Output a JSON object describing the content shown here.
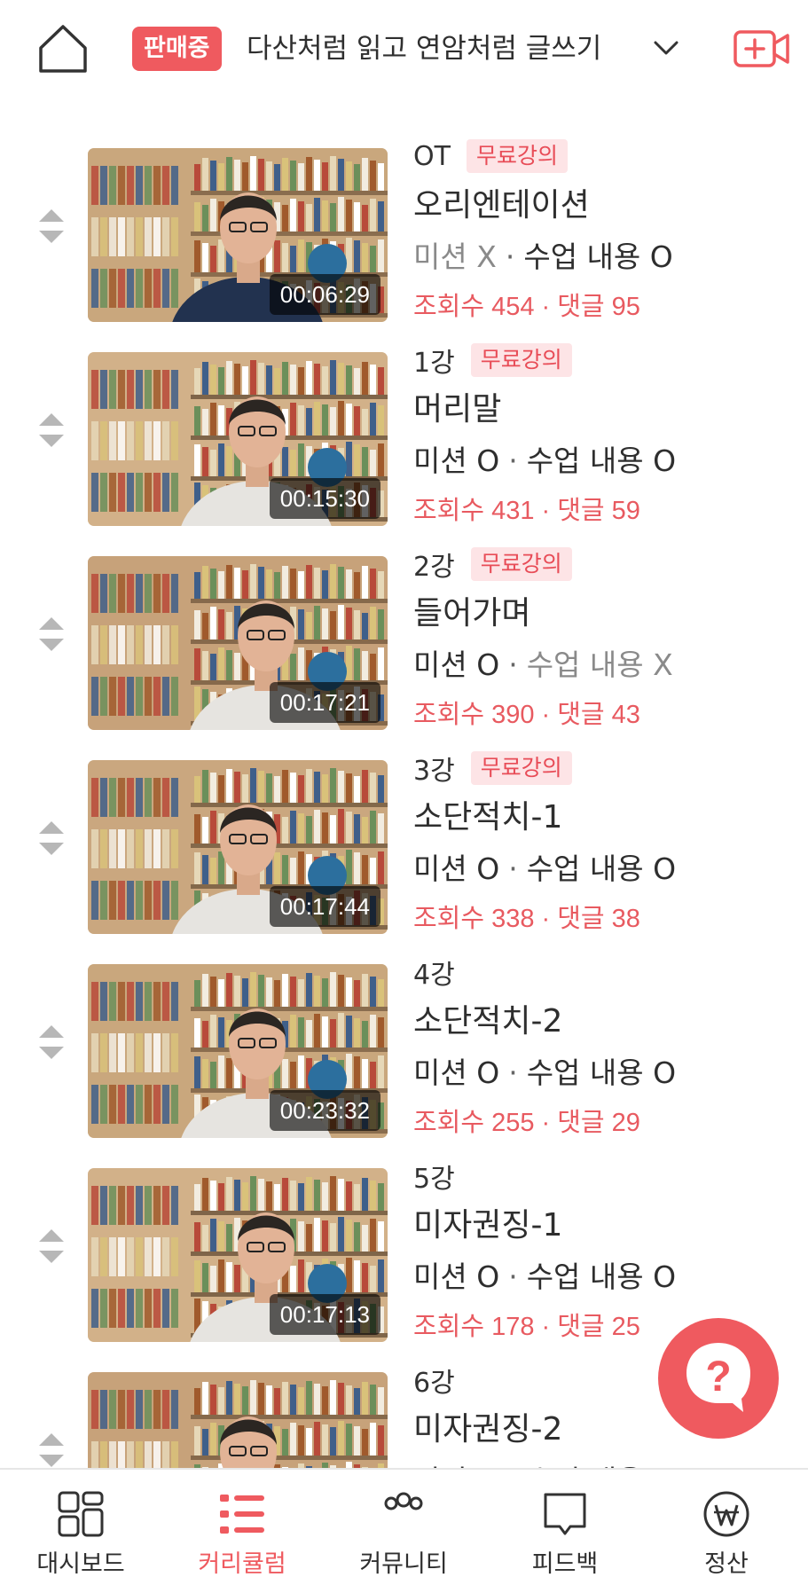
{
  "header": {
    "home_icon": "home-icon",
    "status_badge": "판매중",
    "course_title": "다산처럼 읽고 연암처럼 글쓰기",
    "dropdown_icon": "chevron-down-icon",
    "add_video_icon": "video-add-icon",
    "accent_color": "#ef5a5f"
  },
  "lectures": [
    {
      "number": "OT",
      "free": "무료강의",
      "title": "오리엔테이션",
      "duration": "00:06:29",
      "mission": "미션 X",
      "mission_on": false,
      "content": "수업 내용 O",
      "content_on": true,
      "stats": "조회수 454 · 댓글 95"
    },
    {
      "number": "1강",
      "free": "무료강의",
      "title": "머리말",
      "duration": "00:15:30",
      "mission": "미션 O",
      "mission_on": true,
      "content": "수업 내용 O",
      "content_on": true,
      "stats": "조회수 431 · 댓글 59"
    },
    {
      "number": "2강",
      "free": "무료강의",
      "title": "들어가며",
      "duration": "00:17:21",
      "mission": "미션 O",
      "mission_on": true,
      "content": "수업 내용 X",
      "content_on": false,
      "stats": "조회수 390 · 댓글 43"
    },
    {
      "number": "3강",
      "free": "무료강의",
      "title": "소단적치-1",
      "duration": "00:17:44",
      "mission": "미션 O",
      "mission_on": true,
      "content": "수업 내용 O",
      "content_on": true,
      "stats": "조회수 338 · 댓글 38"
    },
    {
      "number": "4강",
      "free": "",
      "title": "소단적치-2",
      "duration": "00:23:32",
      "mission": "미션 O",
      "mission_on": true,
      "content": "수업 내용 O",
      "content_on": true,
      "stats": "조회수 255 · 댓글 29"
    },
    {
      "number": "5강",
      "free": "",
      "title": "미자권징-1",
      "duration": "00:17:13",
      "mission": "미션 O",
      "mission_on": true,
      "content": "수업 내용 O",
      "content_on": true,
      "stats": "조회수 178 · 댓글 25"
    },
    {
      "number": "6강",
      "free": "",
      "title": "미자권징-2",
      "duration": "",
      "mission": "미션 O",
      "mission_on": true,
      "content": "수업 내용 O",
      "content_on": true,
      "stats": ""
    }
  ],
  "help_button_icon": "question-chat-icon",
  "bottom_nav": [
    {
      "label": "대시보드",
      "icon": "dashboard-grid-icon",
      "active": false
    },
    {
      "label": "커리큘럼",
      "icon": "curriculum-list-icon",
      "active": true
    },
    {
      "label": "커뮤니티",
      "icon": "community-people-icon",
      "active": false
    },
    {
      "label": "피드백",
      "icon": "feedback-flame-icon",
      "active": false
    },
    {
      "label": "정산",
      "icon": "won-coin-icon",
      "active": false
    }
  ]
}
